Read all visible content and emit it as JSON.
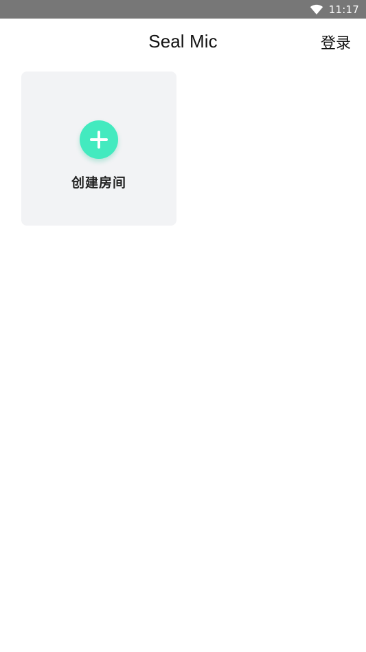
{
  "status_bar": {
    "time": "11:17",
    "icons": [
      "wifi-icon"
    ],
    "background": "#777777"
  },
  "header": {
    "title": "Seal Mic",
    "login_label": "登录"
  },
  "rooms": {
    "create_card": {
      "label": "创建房间",
      "icon": "plus-icon",
      "accent_color": "#43eabf",
      "card_color": "#f2f3f5"
    }
  }
}
